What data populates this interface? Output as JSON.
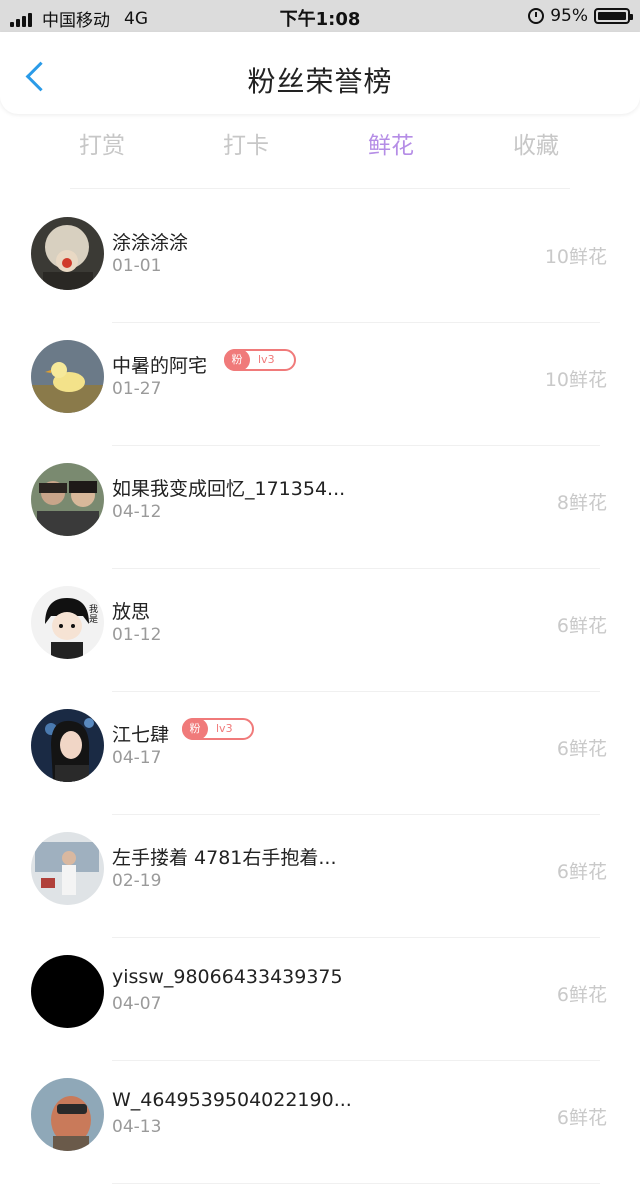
{
  "status_bar": {
    "carrier": "中国移动",
    "network": "4G",
    "time": "下午1:08",
    "battery": "95%"
  },
  "header": {
    "back_icon": "chevron-left-icon",
    "title": "粉丝荣誉榜"
  },
  "tabs": [
    {
      "label": "打赏",
      "active": false
    },
    {
      "label": "打卡",
      "active": false
    },
    {
      "label": "鲜花",
      "active": true
    },
    {
      "label": "收藏",
      "active": false
    }
  ],
  "colors": {
    "accent": "#b58de6",
    "back": "#2a9be8",
    "badge": "#f07a7a",
    "muted": "#c9c9c9"
  },
  "list": [
    {
      "name": "涂涂涂涂",
      "date": "01-01",
      "amount": "10鲜花",
      "badge": null
    },
    {
      "name": "中暑的阿宅",
      "date": "01-27",
      "amount": "10鲜花",
      "badge": {
        "fan": "粉",
        "level": "lv3"
      }
    },
    {
      "name": "如果我变成回忆_171354...",
      "date": "04-12",
      "amount": "8鲜花",
      "badge": null
    },
    {
      "name": "放思",
      "date": "01-12",
      "amount": "6鲜花",
      "badge": null
    },
    {
      "name": "江七肆",
      "date": "04-17",
      "amount": "6鲜花",
      "badge": {
        "fan": "粉",
        "level": "lv3"
      }
    },
    {
      "name": "左手搂着 4781右手抱着...",
      "date": "02-19",
      "amount": "6鲜花",
      "badge": null
    },
    {
      "name": "yissw_98066433439375",
      "date": "04-07",
      "amount": "6鲜花",
      "badge": null
    },
    {
      "name": "W_4649539504022190...",
      "date": "04-13",
      "amount": "6鲜花",
      "badge": null
    }
  ]
}
